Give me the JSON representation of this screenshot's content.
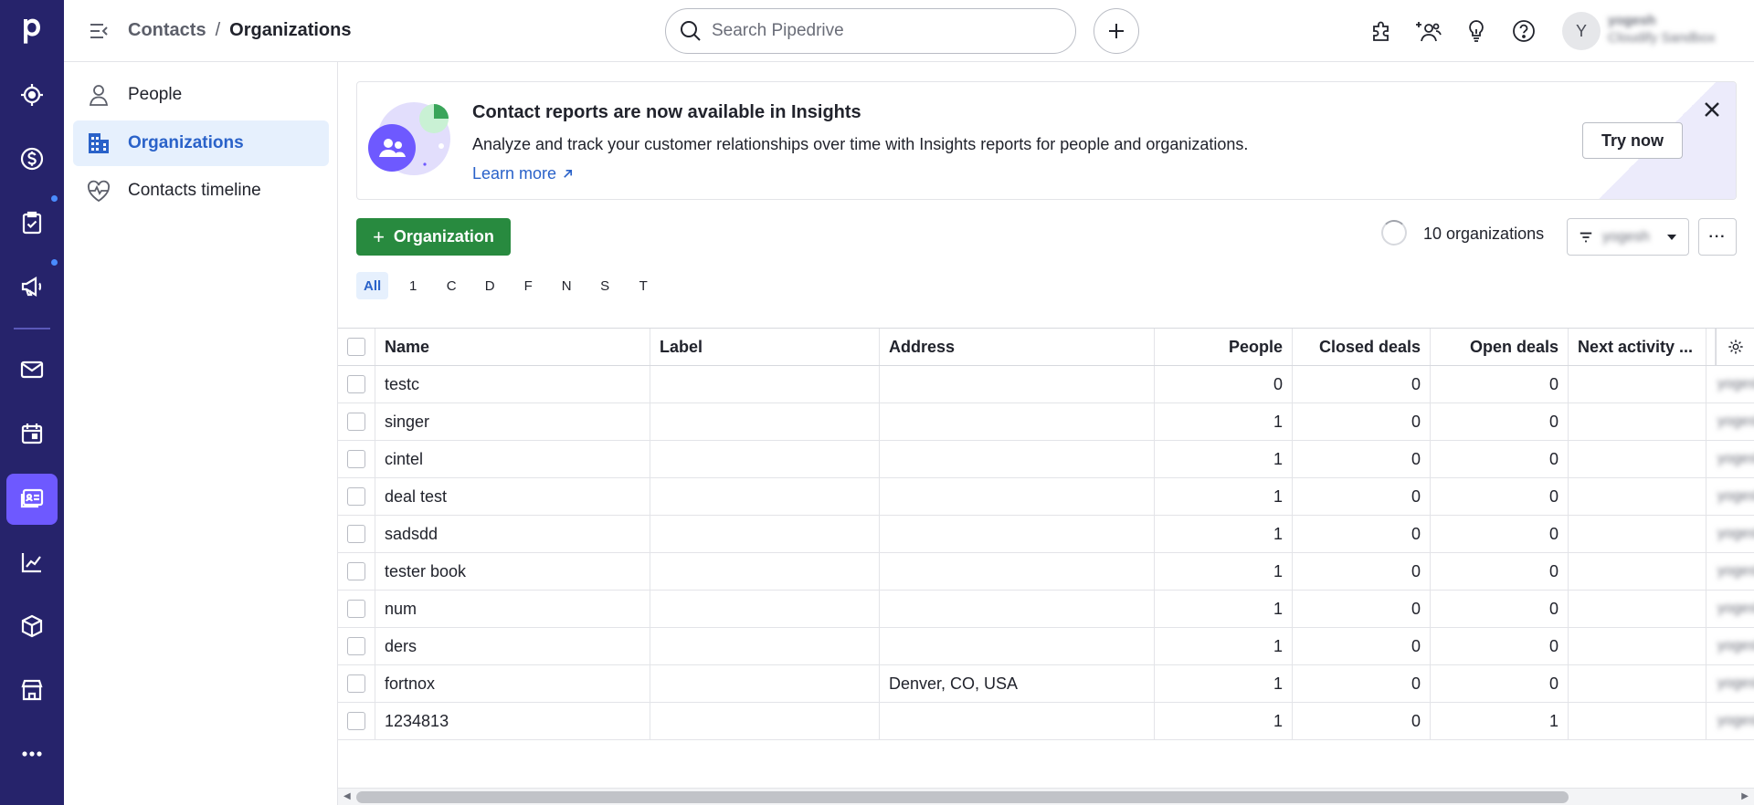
{
  "breadcrumb": {
    "parent": "Contacts",
    "separator": "/",
    "current": "Organizations"
  },
  "search": {
    "placeholder": "Search Pipedrive"
  },
  "user": {
    "initial": "Y",
    "name": "yogesh",
    "company": "Cloudify Sandbox"
  },
  "subnav": {
    "items": [
      {
        "label": "People",
        "icon": "person-icon",
        "active": false
      },
      {
        "label": "Organizations",
        "icon": "building-icon",
        "active": true
      },
      {
        "label": "Contacts timeline",
        "icon": "heart-pulse-icon",
        "active": false
      }
    ]
  },
  "banner": {
    "title": "Contact reports are now available in Insights",
    "text": "Analyze and track your customer relationships over time with Insights reports for people and organizations.",
    "link": "Learn more",
    "button": "Try now"
  },
  "toolbar": {
    "add_label": "Organization",
    "count_label": "10 organizations",
    "filter_label": "yogesh",
    "more_label": "···"
  },
  "alphabet": [
    "All",
    "1",
    "C",
    "D",
    "F",
    "N",
    "S",
    "T"
  ],
  "table": {
    "columns": [
      "Name",
      "Label",
      "Address",
      "People",
      "Closed deals",
      "Open deals",
      "Next activity ..."
    ],
    "owner_placeholder": "yogesh",
    "rows": [
      {
        "name": "testc",
        "label": "",
        "address": "",
        "people": "0",
        "closed": "0",
        "open": "0",
        "next": ""
      },
      {
        "name": "singer",
        "label": "",
        "address": "",
        "people": "1",
        "closed": "0",
        "open": "0",
        "next": ""
      },
      {
        "name": "cintel",
        "label": "",
        "address": "",
        "people": "1",
        "closed": "0",
        "open": "0",
        "next": ""
      },
      {
        "name": "deal test",
        "label": "",
        "address": "",
        "people": "1",
        "closed": "0",
        "open": "0",
        "next": ""
      },
      {
        "name": "sadsdd",
        "label": "",
        "address": "",
        "people": "1",
        "closed": "0",
        "open": "0",
        "next": ""
      },
      {
        "name": "tester book",
        "label": "",
        "address": "",
        "people": "1",
        "closed": "0",
        "open": "0",
        "next": ""
      },
      {
        "name": "num",
        "label": "",
        "address": "",
        "people": "1",
        "closed": "0",
        "open": "0",
        "next": ""
      },
      {
        "name": "ders",
        "label": "",
        "address": "",
        "people": "1",
        "closed": "0",
        "open": "0",
        "next": ""
      },
      {
        "name": "fortnox",
        "label": "",
        "address": "Denver, CO, USA",
        "people": "1",
        "closed": "0",
        "open": "0",
        "next": ""
      },
      {
        "name": "1234813",
        "label": "",
        "address": "",
        "people": "1",
        "closed": "0",
        "open": "1",
        "next": ""
      }
    ]
  },
  "colors": {
    "rail": "#26236b",
    "rail_active": "#6e59ff",
    "primary_green": "#288a3f",
    "link_blue": "#2a62c9",
    "active_bg": "#e6f0fd"
  }
}
